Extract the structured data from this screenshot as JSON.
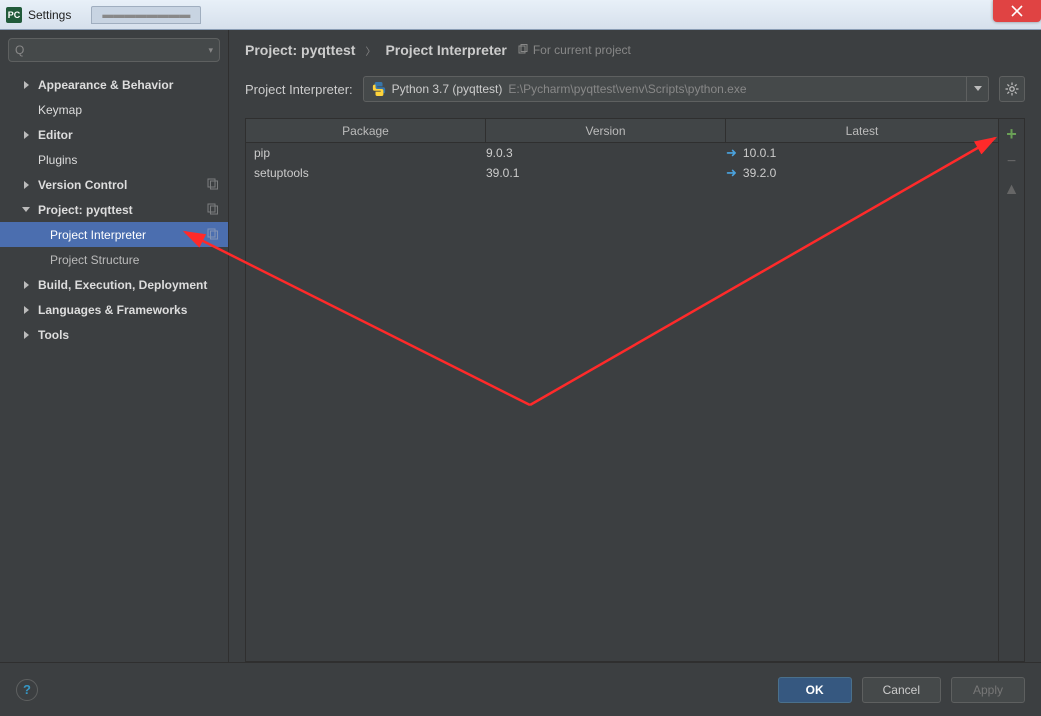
{
  "titlebar": {
    "title": "Settings",
    "bg_tab": "pycharm"
  },
  "sidebar": {
    "search_placeholder": "",
    "items": [
      {
        "label": "Appearance & Behavior",
        "bold": true,
        "arrow": true,
        "expanded": false
      },
      {
        "label": "Keymap",
        "bold": false
      },
      {
        "label": "Editor",
        "bold": true,
        "arrow": true,
        "expanded": false
      },
      {
        "label": "Plugins",
        "bold": false
      },
      {
        "label": "Version Control",
        "bold": true,
        "arrow": true,
        "expanded": false,
        "badge": true
      },
      {
        "label": "Project: pyqttest",
        "bold": true,
        "arrow": true,
        "expanded": true,
        "badge": true
      },
      {
        "label": "Project Interpreter",
        "child": true,
        "selected": true,
        "badge": true
      },
      {
        "label": "Project Structure",
        "child": true
      },
      {
        "label": "Build, Execution, Deployment",
        "bold": true,
        "arrow": true,
        "expanded": false
      },
      {
        "label": "Languages & Frameworks",
        "bold": true,
        "arrow": true,
        "expanded": false
      },
      {
        "label": "Tools",
        "bold": true,
        "arrow": true,
        "expanded": false
      }
    ]
  },
  "breadcrumb": {
    "project": "Project: pyqttest",
    "page": "Project Interpreter",
    "hint": "For current project"
  },
  "interpreter": {
    "label": "Project Interpreter:",
    "name": "Python 3.7 (pyqttest)",
    "path": "E:\\Pycharm\\pyqttest\\venv\\Scripts\\python.exe"
  },
  "table": {
    "headers": {
      "pkg": "Package",
      "ver": "Version",
      "lat": "Latest"
    },
    "rows": [
      {
        "pkg": "pip",
        "ver": "9.0.3",
        "lat": "10.0.1",
        "upgrade": true
      },
      {
        "pkg": "setuptools",
        "ver": "39.0.1",
        "lat": "39.2.0",
        "upgrade": true
      }
    ]
  },
  "footer": {
    "ok": "OK",
    "cancel": "Cancel",
    "apply": "Apply"
  }
}
